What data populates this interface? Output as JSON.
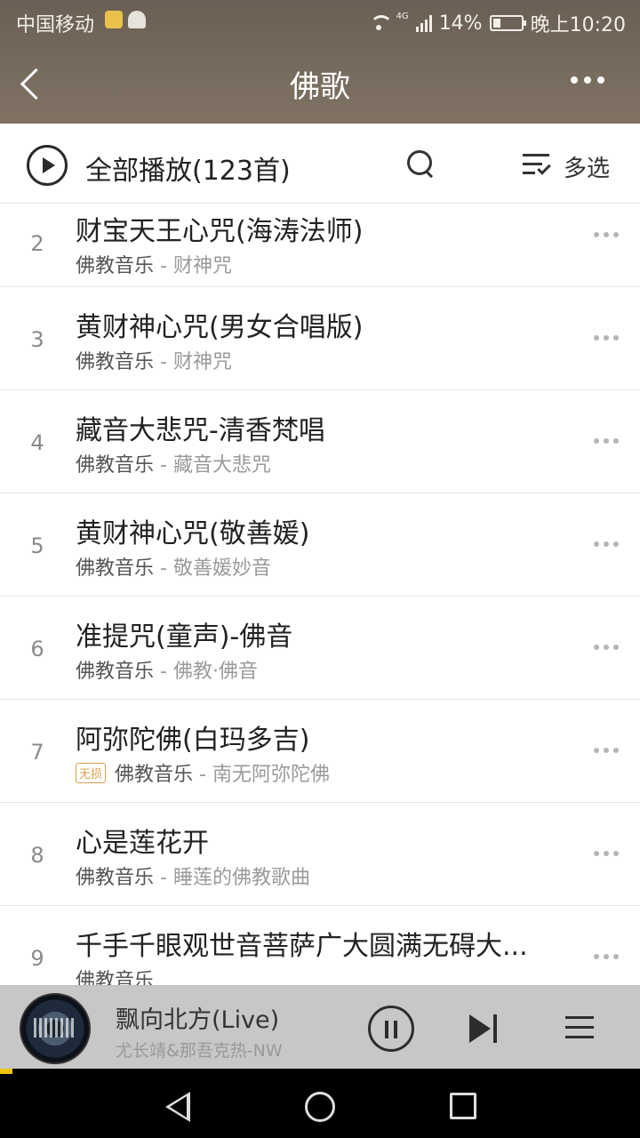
{
  "status_bar": {
    "carrier": "中国移动",
    "network": "4G",
    "battery": "14%",
    "time": "晚上10:20"
  },
  "header": {
    "title": "佛歌"
  },
  "toolbar": {
    "play_all_label": "全部播放(123首)",
    "multi_select_label": "多选"
  },
  "songs": [
    {
      "index": "2",
      "title": "财宝天王心咒(海涛法师)",
      "artist": "佛教音乐",
      "album": " - 财神咒",
      "lossless": false
    },
    {
      "index": "3",
      "title": "黄财神心咒(男女合唱版)",
      "artist": "佛教音乐",
      "album": " - 财神咒",
      "lossless": false
    },
    {
      "index": "4",
      "title": "藏音大悲咒-清香梵唱",
      "artist": "佛教音乐",
      "album": " - 藏音大悲咒",
      "lossless": false
    },
    {
      "index": "5",
      "title": "黄财神心咒(敬善媛)",
      "artist": "佛教音乐",
      "album": " - 敬善媛妙音",
      "lossless": false
    },
    {
      "index": "6",
      "title": "准提咒(童声)-佛音",
      "artist": "佛教音乐",
      "album": " - 佛教·佛音",
      "lossless": false
    },
    {
      "index": "7",
      "title": "阿弥陀佛(白玛多吉)",
      "artist": "佛教音乐",
      "album": " - 南无阿弥陀佛",
      "lossless": true,
      "badge": "无损"
    },
    {
      "index": "8",
      "title": "心是莲花开",
      "artist": "佛教音乐",
      "album": " - 睡莲的佛教歌曲",
      "lossless": false
    },
    {
      "index": "9",
      "title": "千手千眼观世音菩萨广大圆满无碍大...",
      "artist": "佛教音乐",
      "album": "",
      "lossless": false
    }
  ],
  "player": {
    "title": "飘向北方(Live)",
    "artist": "尤长靖&那吾克热-NW",
    "progress": 0.02
  },
  "colors": {
    "header_bg": "#776b5e",
    "accent": "#f0c400",
    "lossless_badge": "#d9a14a"
  }
}
